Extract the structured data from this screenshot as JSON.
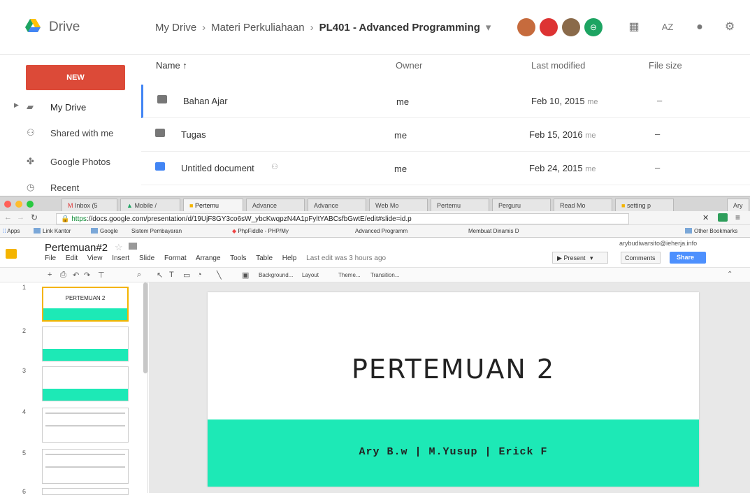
{
  "drive": {
    "app_name": "Drive",
    "breadcrumb": [
      "My Drive",
      "Materi Perkuliahaan",
      "PL401 - Advanced Programming"
    ],
    "new_label": "NEW",
    "sidebar": [
      {
        "label": "My Drive",
        "icon": "drive-folder-icon"
      },
      {
        "label": "Shared with me",
        "icon": "people-icon"
      },
      {
        "label": "Google Photos",
        "icon": "pinwheel-icon"
      },
      {
        "label": "Recent",
        "icon": "clock-icon"
      }
    ],
    "columns": {
      "name": "Name ↑",
      "owner": "Owner",
      "modified": "Last modified",
      "size": "File size"
    },
    "files": [
      {
        "name": "Bahan Ajar",
        "owner": "me",
        "date": "Feb 10, 2015",
        "by": "me",
        "size": "–",
        "type": "folder"
      },
      {
        "name": "Tugas",
        "owner": "me",
        "date": "Feb 15, 2016",
        "by": "me",
        "size": "–",
        "type": "folder"
      },
      {
        "name": "Untitled document",
        "owner": "me",
        "date": "Feb 24, 2015",
        "by": "me",
        "size": "–",
        "type": "doc"
      }
    ]
  },
  "browser": {
    "tabs": [
      "Inbox (5",
      "Mobile /",
      "Pertemu",
      "Advance",
      "Advance",
      "Web Mo",
      "Pertemu",
      "Perguru",
      "Read Mo",
      "setting p"
    ],
    "profile": "Ary",
    "url_scheme": "https",
    "url_rest": "://docs.google.com/presentation/d/19UjF8GY3co6sW_ybcKwqpzN4A1pFyltYABCsfbGwtE/edit#slide=id.p",
    "bookmarks": [
      "Apps",
      "Link Kantor",
      "Google",
      "Sistem Pembayaran",
      "PhpFiddle - PHP/My",
      "Advanced Programm",
      "Membuat Dinamis D"
    ],
    "other_bookmarks": "Other Bookmarks"
  },
  "slides": {
    "doc_title": "Pertemuan#2",
    "menu": [
      "File",
      "Edit",
      "View",
      "Insert",
      "Slide",
      "Format",
      "Arrange",
      "Tools",
      "Table",
      "Help"
    ],
    "edit_status": "Last edit was 3 hours ago",
    "email": "arybudiwarsito@ieherja.info",
    "present_label": "Present",
    "comments_label": "Comments",
    "share_label": "Share",
    "toolbar_text": [
      "Background...",
      "Layout",
      "Theme...",
      "Transition..."
    ],
    "thumbnails": [
      {
        "num": "1",
        "title": "PERTEMUAN 2"
      },
      {
        "num": "2",
        "title": ""
      },
      {
        "num": "3",
        "title": ""
      },
      {
        "num": "4",
        "title": ""
      },
      {
        "num": "5",
        "title": ""
      },
      {
        "num": "6",
        "title": ""
      }
    ],
    "current_slide": {
      "title": "Pertemuan 2",
      "subtitle": "Ary B.w | M.Yusup | Erick F"
    },
    "accent_color": "#1de9b6"
  }
}
